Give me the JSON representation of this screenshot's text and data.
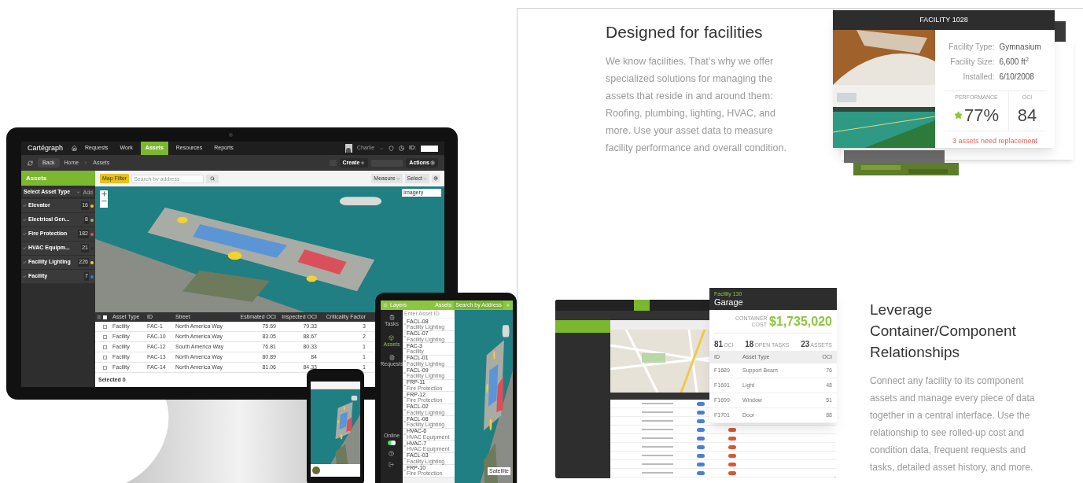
{
  "monitor": {
    "logo": "Cartégraph",
    "nav": [
      {
        "label": "Requests",
        "selected": false
      },
      {
        "label": "Work",
        "selected": false
      },
      {
        "label": "Assets",
        "selected": true
      },
      {
        "label": "Resources",
        "selected": false
      },
      {
        "label": "Reports",
        "selected": false
      }
    ],
    "user": "Charlie",
    "id_label": "ID:",
    "back": "Back",
    "breadcrumb": [
      "Home",
      "Assets"
    ],
    "create": "Create",
    "actions": "Actions",
    "sidebar": {
      "title": "Assets",
      "select": "Select Asset Type",
      "add": "Add",
      "items": [
        {
          "name": "Elevator",
          "count": "16",
          "color": "#e8c53a",
          "checked": true
        },
        {
          "name": "Electrical Gen...",
          "count": "8",
          "color": "#8cc63f",
          "checked": true
        },
        {
          "name": "Fire Protection",
          "count": "182",
          "color": "#e0505a",
          "checked": true
        },
        {
          "name": "HVAC Equipm...",
          "count": "21",
          "color": "#2e2e2e",
          "checked": true
        },
        {
          "name": "Facility Lighting",
          "count": "226",
          "color": "#f2d22e",
          "checked": true
        },
        {
          "name": "Facility",
          "count": "7",
          "color": "#2f7fd0",
          "checked": true
        }
      ]
    },
    "map_filter": "Map Filter",
    "search_placeholder": "Search by address",
    "measure": "Measure",
    "select": "Select",
    "layer": "Imagery",
    "table": {
      "select_all_checked": true,
      "columns": [
        "Asset Type",
        "ID",
        "Street",
        "Estimated OCI",
        "Inspected OCI",
        "Criticality Factor"
      ],
      "rows": [
        {
          "cells": [
            "Facility",
            "FAC-1",
            "North America Way",
            "75.69",
            "79.33",
            "3"
          ],
          "checked": false
        },
        {
          "cells": [
            "Facility",
            "FAC-10",
            "North America Way",
            "83.05",
            "88.67",
            "2"
          ],
          "checked": false
        },
        {
          "cells": [
            "Facility",
            "FAC-12",
            "South America Way",
            "76.81",
            "80.33",
            "1"
          ],
          "checked": false
        },
        {
          "cells": [
            "Facility",
            "FAC-13",
            "North America Way",
            "80.89",
            "84",
            "1"
          ],
          "checked": false
        },
        {
          "cells": [
            "Facility",
            "FAC-14",
            "North America Way",
            "81.06",
            "84.33",
            "1"
          ],
          "checked": false
        }
      ],
      "footer": "Selected 0"
    }
  },
  "tablet": {
    "layers": "Layers",
    "title": "Assets",
    "search": "Search by Address",
    "id_placeholder": "Enter Asset ID",
    "side": [
      "Tasks",
      "Assets",
      "Requests"
    ],
    "online": {
      "label": "Online",
      "on": true
    },
    "satellite": "Satellite",
    "items": [
      {
        "id": "FACL-08",
        "type": "Facility Lighting"
      },
      {
        "id": "FACL-07",
        "type": "Facility Lighting"
      },
      {
        "id": "FAC-3",
        "type": "Facility"
      },
      {
        "id": "FACL-01",
        "type": "Facility Lighting"
      },
      {
        "id": "FACL-09",
        "type": "Facility Lighting"
      },
      {
        "id": "FRP-11",
        "type": "Fire Protection"
      },
      {
        "id": "FRP-12",
        "type": "Fire Protection"
      },
      {
        "id": "FACL-02",
        "type": "Facility Lighting"
      },
      {
        "id": "FACL-08",
        "type": "Facility Lighting"
      },
      {
        "id": "HVAC-6",
        "type": "HVAC Equipment"
      },
      {
        "id": "HVAC-7",
        "type": "HVAC Equipment"
      },
      {
        "id": "FACL-03",
        "type": "Facility Lighting"
      },
      {
        "id": "FRP-10",
        "type": "Fire Protection"
      }
    ]
  },
  "facilities": {
    "heading": "Designed for facilities",
    "paragraph": "We know facilities. That’s why we offer specialized solutions for managing the assets that reside in and around them: Roofing, plumbing, lighting, HVAC, and more. Use your asset data to measure facility performance and overall condition.",
    "card": {
      "title": "FACILITY 1028",
      "fields": [
        {
          "label": "Facility Type:",
          "value": "Gymnasium"
        },
        {
          "label": "Facility Size:",
          "value": "6,600 ft$^{2}$"
        },
        {
          "label": "Installed:",
          "value": "6/10/2008"
        }
      ],
      "performance_label": "PERFORMANCE",
      "performance": "77%",
      "oci_label": "OCI",
      "oci": "84",
      "warning": "3 assets need replacement"
    }
  },
  "relationships": {
    "heading": "Leverage Container/Component Relationships",
    "paragraph": "Connect any facility to its component assets and manage every piece of data together in a central interface. Use the relationship to see rolled-up cost and condition data, frequent requests and tasks, detailed asset history, and more.",
    "popup": {
      "subtitle": "Facility 130",
      "title": "Garage",
      "cost_label": "CONTAINER COST",
      "cost": "$1,735,020",
      "stats": [
        {
          "value": "81",
          "label": "OCI"
        },
        {
          "value": "18",
          "label": "OPEN TASKS"
        },
        {
          "value": "23",
          "label": "ASSETS"
        }
      ],
      "columns": [
        "ID",
        "Asset Type",
        "OCI"
      ],
      "rows": [
        [
          "F1689",
          "Support Beam",
          "76"
        ],
        [
          "F1691",
          "Light",
          "48"
        ],
        [
          "F1699",
          "Window",
          "51"
        ],
        [
          "F1701",
          "Door",
          "88"
        ]
      ]
    }
  }
}
